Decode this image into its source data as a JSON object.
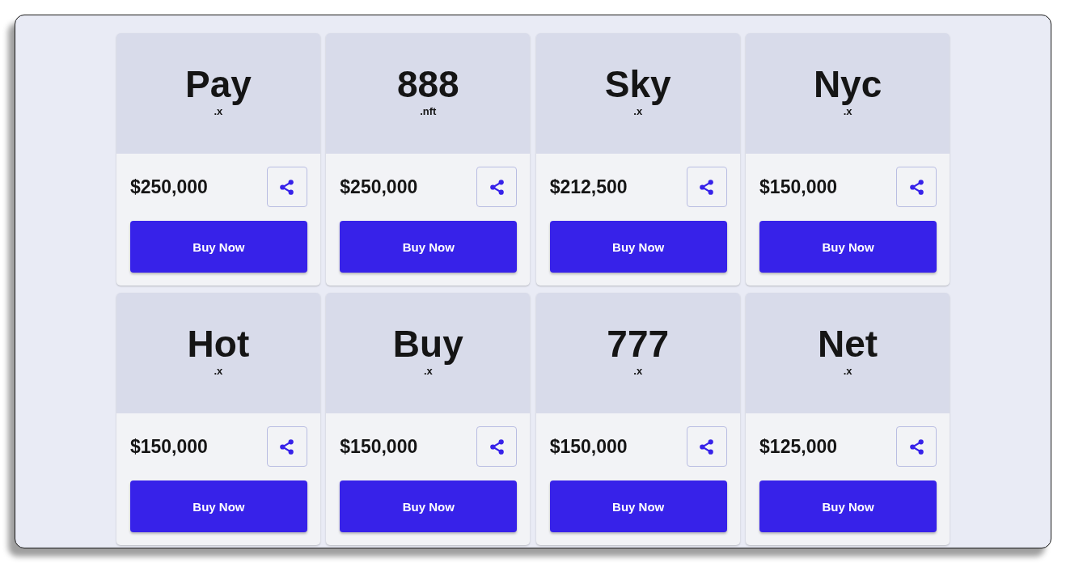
{
  "listings": [
    {
      "name": "Pay",
      "extension": ".x",
      "price": "$250,000",
      "buy_label": "Buy Now"
    },
    {
      "name": "888",
      "extension": ".nft",
      "price": "$250,000",
      "buy_label": "Buy Now"
    },
    {
      "name": "Sky",
      "extension": ".x",
      "price": "$212,500",
      "buy_label": "Buy Now"
    },
    {
      "name": "Nyc",
      "extension": ".x",
      "price": "$150,000",
      "buy_label": "Buy Now"
    },
    {
      "name": "Hot",
      "extension": ".x",
      "price": "$150,000",
      "buy_label": "Buy Now"
    },
    {
      "name": "Buy",
      "extension": ".x",
      "price": "$150,000",
      "buy_label": "Buy Now"
    },
    {
      "name": "777",
      "extension": ".x",
      "price": "$150,000",
      "buy_label": "Buy Now"
    },
    {
      "name": "Net",
      "extension": ".x",
      "price": "$125,000",
      "buy_label": "Buy Now"
    }
  ]
}
